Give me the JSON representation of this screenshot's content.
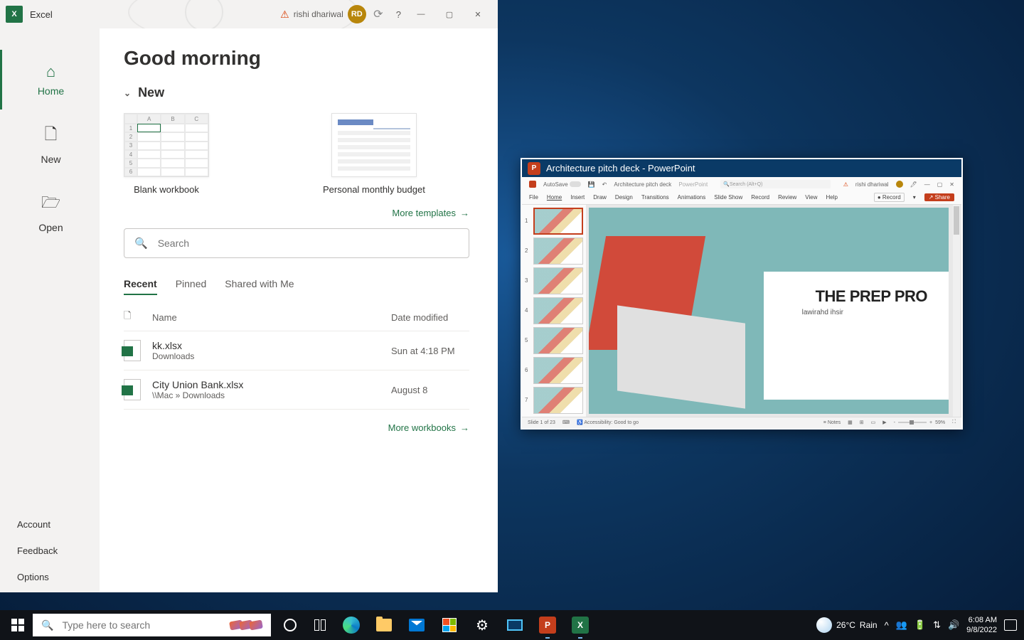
{
  "excel": {
    "app_title": "Excel",
    "user_name": "rishi dhariwal",
    "user_initials": "RD",
    "nav": {
      "home": "Home",
      "new": "New",
      "open": "Open",
      "account": "Account",
      "feedback": "Feedback",
      "options": "Options"
    },
    "greeting": "Good morning",
    "new_section": "New",
    "templates": {
      "blank": "Blank workbook",
      "budget": "Personal monthly budget"
    },
    "more_templates": "More templates",
    "search_placeholder": "Search",
    "tabs": {
      "recent": "Recent",
      "pinned": "Pinned",
      "shared": "Shared with Me"
    },
    "col_name": "Name",
    "col_date": "Date modified",
    "files": [
      {
        "name": "kk.xlsx",
        "location": "Downloads",
        "date": "Sun at 4:18 PM"
      },
      {
        "name": "City Union Bank.xlsx",
        "location": "\\\\Mac » Downloads",
        "date": "August 8"
      }
    ],
    "more_workbooks": "More workbooks"
  },
  "powerpoint": {
    "window_title": "Architecture pitch deck - PowerPoint",
    "autosave": "AutoSave",
    "doc_name": "Architecture pitch deck",
    "app_name": "PowerPoint",
    "search_placeholder": "Search (Alt+Q)",
    "user_name": "rishi dhariwal",
    "ribbon": [
      "File",
      "Home",
      "Insert",
      "Draw",
      "Design",
      "Transitions",
      "Animations",
      "Slide Show",
      "Record",
      "Review",
      "View",
      "Help"
    ],
    "record_btn": "Record",
    "share_btn": "Share",
    "slide_title": "THE PREP PRO",
    "slide_subtitle": "lawirahd ihsir",
    "slide_count": 7,
    "status_slide": "Slide 1 of 23",
    "status_access": "Accessibility: Good to go",
    "status_notes": "Notes",
    "zoom": "59%"
  },
  "taskbar": {
    "search_placeholder": "Type here to search",
    "weather_temp": "26°C",
    "weather_cond": "Rain",
    "time": "6:08 AM",
    "date": "9/8/2022"
  }
}
